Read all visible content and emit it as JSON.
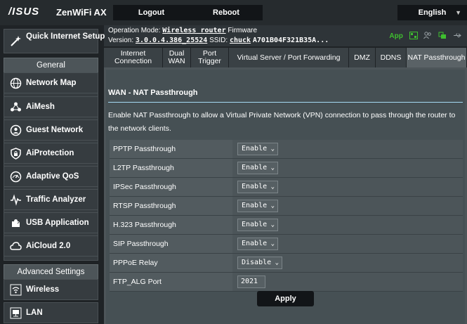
{
  "header": {
    "logo": "/ISUS",
    "product": "ZenWiFi AX",
    "logout_label": "Logout",
    "reboot_label": "Reboot",
    "language": "English"
  },
  "info": {
    "opmode_label": "Operation Mode:",
    "opmode_value": "Wireless router",
    "firmware_label": "Firmware",
    "version_label": "Version:",
    "version_value": "3.0.0.4.386_25524",
    "ssid_label": "SSID:",
    "ssid_value": "chuck",
    "ssid_extra": "A701B04F321B35A...",
    "app_label": "App"
  },
  "sidebar": {
    "quick_setup": "Quick Internet Setup",
    "general_header": "General",
    "general_items": [
      {
        "label": "Network Map",
        "icon": "globe-icon"
      },
      {
        "label": "AiMesh",
        "icon": "mesh-icon"
      },
      {
        "label": "Guest Network",
        "icon": "guest-globe-icon"
      },
      {
        "label": "AiProtection",
        "icon": "lock-shield-icon"
      },
      {
        "label": "Adaptive QoS",
        "icon": "gauge-icon"
      },
      {
        "label": "Traffic Analyzer",
        "icon": "pulse-icon"
      },
      {
        "label": "USB Application",
        "icon": "puzzle-icon"
      },
      {
        "label": "AiCloud 2.0",
        "icon": "cloud-icon"
      }
    ],
    "advanced_header": "Advanced Settings",
    "advanced_items": [
      {
        "label": "Wireless",
        "icon": "wifi-icon"
      },
      {
        "label": "LAN",
        "icon": "lan-icon"
      }
    ]
  },
  "tabs": [
    {
      "label": "Internet Connection",
      "active": false
    },
    {
      "label": "Dual WAN",
      "active": false
    },
    {
      "label": "Port Trigger",
      "active": false
    },
    {
      "label": "Virtual Server / Port Forwarding",
      "active": false
    },
    {
      "label": "DMZ",
      "active": false
    },
    {
      "label": "DDNS",
      "active": false
    },
    {
      "label": "NAT Passthrough",
      "active": true
    }
  ],
  "main": {
    "title": "WAN - NAT Passthrough",
    "description": "Enable NAT Passthrough to allow a Virtual Private Network (VPN) connection to pass through the router to the network clients.",
    "settings": [
      {
        "label": "PPTP Passthrough",
        "value": "Enable"
      },
      {
        "label": "L2TP Passthrough",
        "value": "Enable"
      },
      {
        "label": "IPSec Passthrough",
        "value": "Enable"
      },
      {
        "label": "RTSP Passthrough",
        "value": "Enable"
      },
      {
        "label": "H.323 Passthrough",
        "value": "Enable"
      },
      {
        "label": "SIP Passthrough",
        "value": "Enable"
      },
      {
        "label": "PPPoE Relay",
        "value": "Disable"
      }
    ],
    "ftp_label": "FTP_ALG Port",
    "ftp_value": "2021",
    "apply_label": "Apply"
  },
  "colors": {
    "accent_green": "#3fbf2f",
    "divider_blue": "#a5d9f4"
  }
}
